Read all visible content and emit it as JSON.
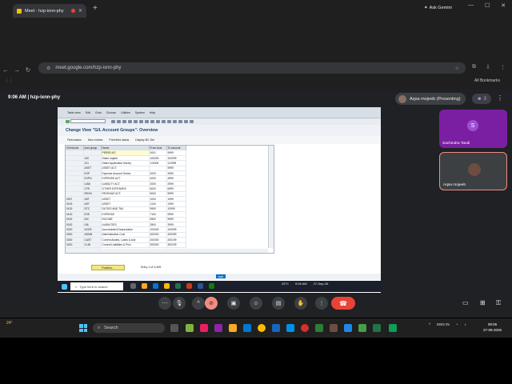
{
  "browser": {
    "tab_title": "Meet - hzp-ixnn-phy",
    "gemini_label": "Ask Gemini",
    "url": "meet.google.com/hzp-ixnn-phy",
    "bookmarks_label": "All Bookmarks"
  },
  "meet": {
    "time_code": "9:06 AM  |  hzp-ixnn-phy",
    "presenter": "Aqsa mojeeb (Presenting)",
    "participant_count": "3",
    "participants": [
      {
        "initial": "S",
        "name": "Sachindra Tandi"
      },
      {
        "name": "Aqsa mojeeb"
      }
    ]
  },
  "sap": {
    "menu": [
      "Table view",
      "Edit",
      "Goto",
      "Choose",
      "Utilities",
      "System",
      "Help"
    ],
    "title": "Change View \"G/L Account Groups\": Overview",
    "app_toolbar": [
      "Field status",
      "New entries",
      "Print field status",
      "Display BC Set"
    ],
    "columns": [
      "Chrt/Accts",
      "Acct group",
      "Name",
      "From Acct",
      "To account"
    ],
    "rows": [
      [
        "",
        "",
        "PERSE A/C",
        "0001",
        "9999"
      ],
      [
        "",
        "100",
        "Share capital",
        "100000",
        "100999"
      ],
      [
        "",
        "121",
        "Share Application Money",
        "110000",
        "110999"
      ],
      [
        "",
        "ASST",
        "ASSET ACT.",
        "",
        "9999"
      ],
      [
        "",
        "EXP",
        "Expense Account Series",
        "4000",
        "4999"
      ],
      [
        "",
        "EXPN",
        "EXPENSE ACT.",
        "4000",
        "4999"
      ],
      [
        "",
        "LIAB",
        "LIABILITY ACT.",
        "2000",
        "2999"
      ],
      [
        "",
        "OTE",
        "OTHER EXPENSES",
        "6000",
        "6999"
      ],
      [
        "",
        "REVN",
        "REVENUE ACT.",
        "5000",
        "5999"
      ],
      [
        "0007",
        "AST",
        "ASSET",
        "1000",
        "1999"
      ],
      [
        "0100",
        "AST",
        "ASSET",
        "1100",
        "1999"
      ],
      [
        "0100",
        "DTC",
        "DUTIES AND TAX",
        "9900",
        "10999"
      ],
      [
        "0100",
        "EXE",
        "EXPENSE",
        "7100",
        "9999"
      ],
      [
        "0100",
        "INC",
        "INCOME",
        "5500",
        "5999"
      ],
      [
        "0100",
        "LBL",
        "LIABILITIES",
        "3500",
        "3999"
      ],
      [
        "0200",
        "ACDE",
        "Accumulated Depreciation",
        "100000",
        "100099"
      ],
      [
        "0200",
        "ADMN",
        "Administration Cost",
        "400000",
        "400099"
      ],
      [
        "0200",
        "CAST",
        "Current Assets, Loans & Adv",
        "200000",
        "200199"
      ],
      [
        "0200",
        "CLIB",
        "Current Liabilities & Prov",
        "300000",
        "300199"
      ],
      [
        "0200",
        "FAST",
        "Fixed Assets",
        "100000",
        "100099"
      ]
    ],
    "position_button": "Position...",
    "entry_text": "Entry 1 of 3,499",
    "sap_logo": "SAP",
    "inner_search": "Type here to search",
    "inner_temp": "25°C",
    "inner_time": "9:06 AM",
    "inner_date": "27-Sep-26"
  },
  "taskbar": {
    "weather": "24°",
    "search": "Search",
    "lang": "ENG IN",
    "time": "09:06",
    "date": "27-09-2026"
  }
}
